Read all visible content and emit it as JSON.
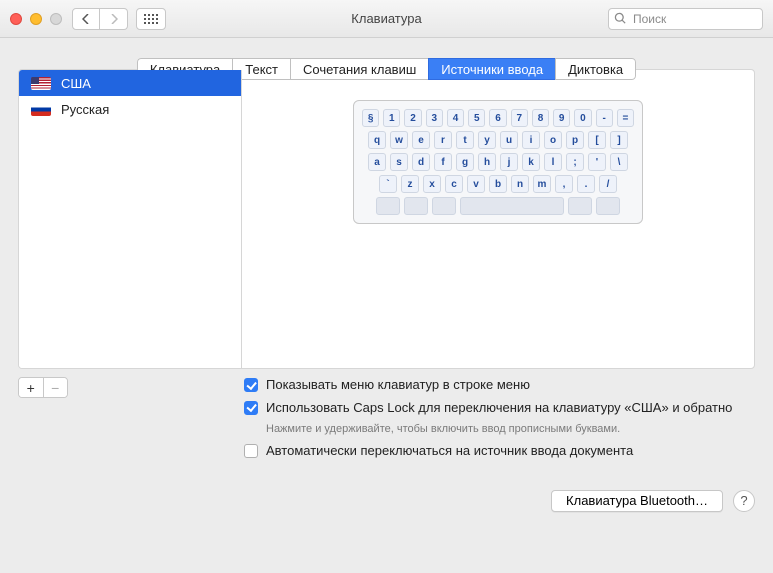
{
  "window": {
    "title": "Клавиатура",
    "search_placeholder": "Поиск"
  },
  "tabs": {
    "items": [
      "Клавиатура",
      "Текст",
      "Сочетания клавиш",
      "Источники ввода",
      "Диктовка"
    ],
    "active_index": 3
  },
  "sources": {
    "items": [
      {
        "name": "США",
        "flag": "us",
        "selected": true
      },
      {
        "name": "Русская",
        "flag": "ru",
        "selected": false
      }
    ]
  },
  "keyboard_rows": [
    [
      "§",
      "1",
      "2",
      "3",
      "4",
      "5",
      "6",
      "7",
      "8",
      "9",
      "0",
      "-",
      "="
    ],
    [
      "q",
      "w",
      "e",
      "r",
      "t",
      "y",
      "u",
      "i",
      "o",
      "p",
      "[",
      "]"
    ],
    [
      "a",
      "s",
      "d",
      "f",
      "g",
      "h",
      "j",
      "k",
      "l",
      ";",
      "'",
      "\\"
    ],
    [
      "`",
      "z",
      "x",
      "c",
      "v",
      "b",
      "n",
      "m",
      ",",
      ".",
      "/"
    ]
  ],
  "options": {
    "show_menu": {
      "checked": true,
      "label": "Показывать меню клавиатур в строке меню"
    },
    "caps_lock": {
      "checked": true,
      "label": "Использовать Caps Lock для переключения на клавиатуру «США» и обратно",
      "hint": "Нажмите и удерживайте, чтобы включить ввод прописными буквами."
    },
    "auto_switch": {
      "checked": false,
      "label": "Автоматически переключаться на источник ввода документа"
    }
  },
  "footer": {
    "bluetooth_button": "Клавиатура Bluetooth…",
    "help": "?"
  }
}
